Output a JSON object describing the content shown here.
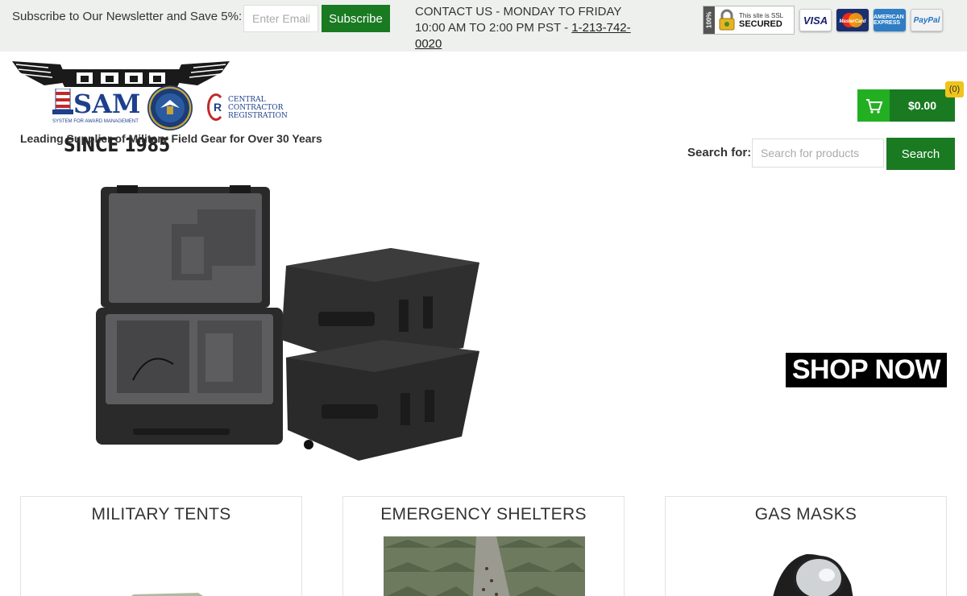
{
  "topbar": {
    "newsletter_label": "Subscribe to Our Newsletter and Save 5%:",
    "email_placeholder": "Enter Email",
    "subscribe_label": "Subscribe",
    "contact_line1": "CONTACT US - MONDAY TO FRIDAY",
    "contact_line2": "10:00 AM TO 2:00 PM PST - ",
    "phone": "1-213-742-0020",
    "badges": {
      "ssl_percent": "100%",
      "ssl_small": "This site is SSL",
      "ssl_big": "SECURED",
      "visa": "VISA",
      "mastercard": "MasterCard",
      "amex": "AMERICAN EXPRESS",
      "paypal": "PayPal"
    }
  },
  "header": {
    "since": "SINCE 1985",
    "sam": "SAM",
    "sam_sub": "SYSTEM FOR AWARD MANAGEMENT",
    "ccr": [
      "CENTRAL",
      "CONTRACTOR",
      "REGISTRATION"
    ],
    "tagline": "Leading Supplier of Military Field Gear for Over 30 Years",
    "cart_amount": "$0.00",
    "cart_count": "(0)",
    "search_label": "Search for:",
    "search_placeholder": "Search for products",
    "search_button": "Search"
  },
  "banner": {
    "shop_now": "SHOP NOW"
  },
  "categories": [
    {
      "title": "MILITARY TENTS"
    },
    {
      "title": "EMERGENCY SHELTERS"
    },
    {
      "title": "GAS MASKS"
    }
  ],
  "colors": {
    "brand_green": "#1a7a22",
    "cart_light_green": "#22b022",
    "badge_yellow": "#f0c419",
    "topbar_bg": "#eef0ee"
  }
}
